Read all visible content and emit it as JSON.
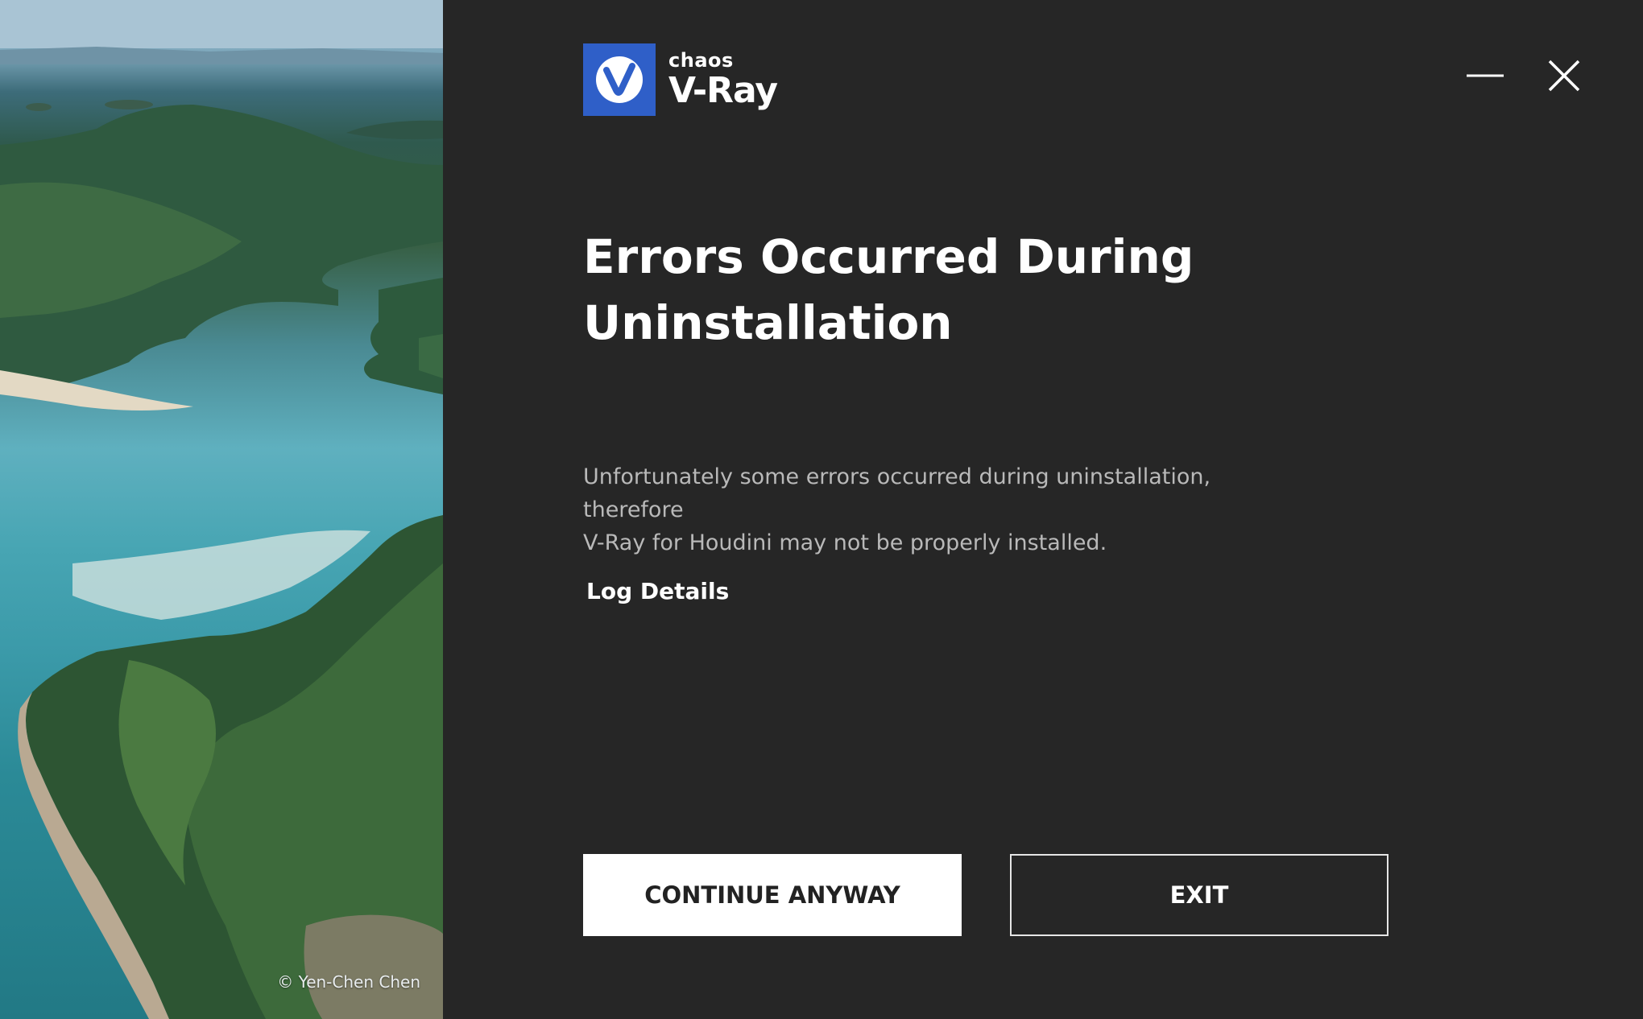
{
  "window": {
    "brand": "chaos",
    "product": "V-Ray"
  },
  "photo": {
    "credit": "© Yen-Chen Chen"
  },
  "content": {
    "title_line1": "Errors Occurred During",
    "title_line2": "Uninstallation",
    "message_line1": "Unfortunately some errors occurred during uninstallation, therefore",
    "message_line2": "V-Ray for Houdini may not be properly installed.",
    "log_link": "Log Details"
  },
  "buttons": {
    "continue_label": "CONTINUE ANYWAY",
    "exit_label": "EXIT"
  },
  "icons": {
    "logo": "vray-logo-icon",
    "minimize": "minimize-icon",
    "close": "close-icon"
  },
  "colors": {
    "background": "#262626",
    "accent": "#2f5fc8",
    "text_primary": "#ffffff",
    "text_secondary": "#b9b9b9"
  }
}
